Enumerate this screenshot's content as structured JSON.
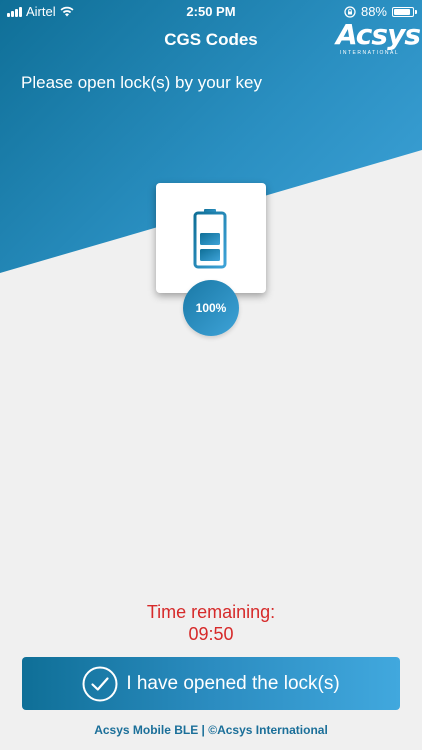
{
  "status_bar": {
    "carrier": "Airtel",
    "time": "2:50 PM",
    "battery": "88%"
  },
  "nav": {
    "title": "CGS Codes",
    "logo_text": "Acsys",
    "logo_sub": "INTERNATIONAL"
  },
  "main": {
    "instruction": "Please open lock(s) by your key",
    "battery_percent": "100%",
    "battery_level": 1.0
  },
  "timer": {
    "label": "Time remaining:",
    "value": "09:50"
  },
  "confirm_button": {
    "label": "I have opened the lock(s)"
  },
  "footer": {
    "text": "Acsys Mobile BLE | ©Acsys International"
  },
  "colors": {
    "brand_dark": "#0f6f97",
    "brand_light": "#41a8de",
    "timer_red": "#d62a2a",
    "footer_blue": "#1b6f99",
    "background": "#f0f0f0"
  },
  "icons": {
    "status_signal": "signal-bars-icon",
    "status_wifi": "wifi-icon",
    "status_lock": "rotation-lock-icon",
    "status_battery": "battery-status-icon",
    "lock_battery": "battery-icon",
    "confirm": "check-circle-icon"
  }
}
